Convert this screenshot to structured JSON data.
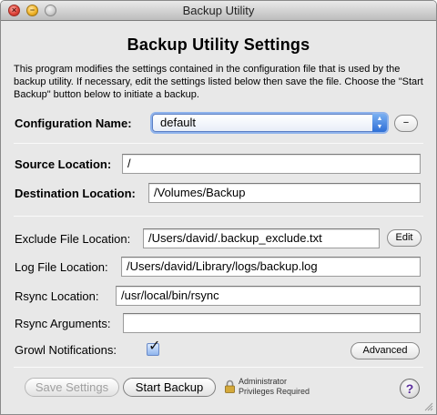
{
  "window": {
    "title": "Backup Utility"
  },
  "heading": "Backup Utility Settings",
  "description": "This program modifies the settings contained in the configuration file that is used by the backup utility.  If necessary, edit the settings listed below then save the file. Choose the \"Start Backup\" button below to initiate a backup.",
  "config": {
    "label": "Configuration Name:",
    "selected": "default",
    "remove_button": "−"
  },
  "source": {
    "label": "Source Location:",
    "value": "/"
  },
  "destination": {
    "label": "Destination Location:",
    "value": "/Volumes/Backup"
  },
  "exclude": {
    "label": "Exclude File Location:",
    "value": "/Users/david/.backup_exclude.txt",
    "edit_button": "Edit"
  },
  "log": {
    "label": "Log File Location:",
    "value": "/Users/david/Library/logs/backup.log"
  },
  "rsync": {
    "label": "Rsync Location:",
    "value": "/usr/local/bin/rsync"
  },
  "rsync_args": {
    "label": "Rsync Arguments:",
    "value": ""
  },
  "growl": {
    "label": "Growl Notifications:",
    "checked": true
  },
  "advanced_button": "Advanced",
  "footer": {
    "save_button": "Save Settings",
    "start_button": "Start Backup",
    "admin_line1": "Administrator",
    "admin_line2": "Privileges Required",
    "help_button": "?"
  },
  "colors": {
    "window_bg": "#e8e8e8",
    "focus_ring": "#8fb3ec",
    "popup_arrow": "#2f6fd6",
    "help_glyph": "#5a2d9c"
  },
  "icons": [
    "close-button-icon",
    "minimize-button-icon",
    "zoom-button-icon",
    "popup-arrows-icon",
    "checkmark-icon",
    "lock-icon",
    "help-icon",
    "resize-grip-icon"
  ]
}
